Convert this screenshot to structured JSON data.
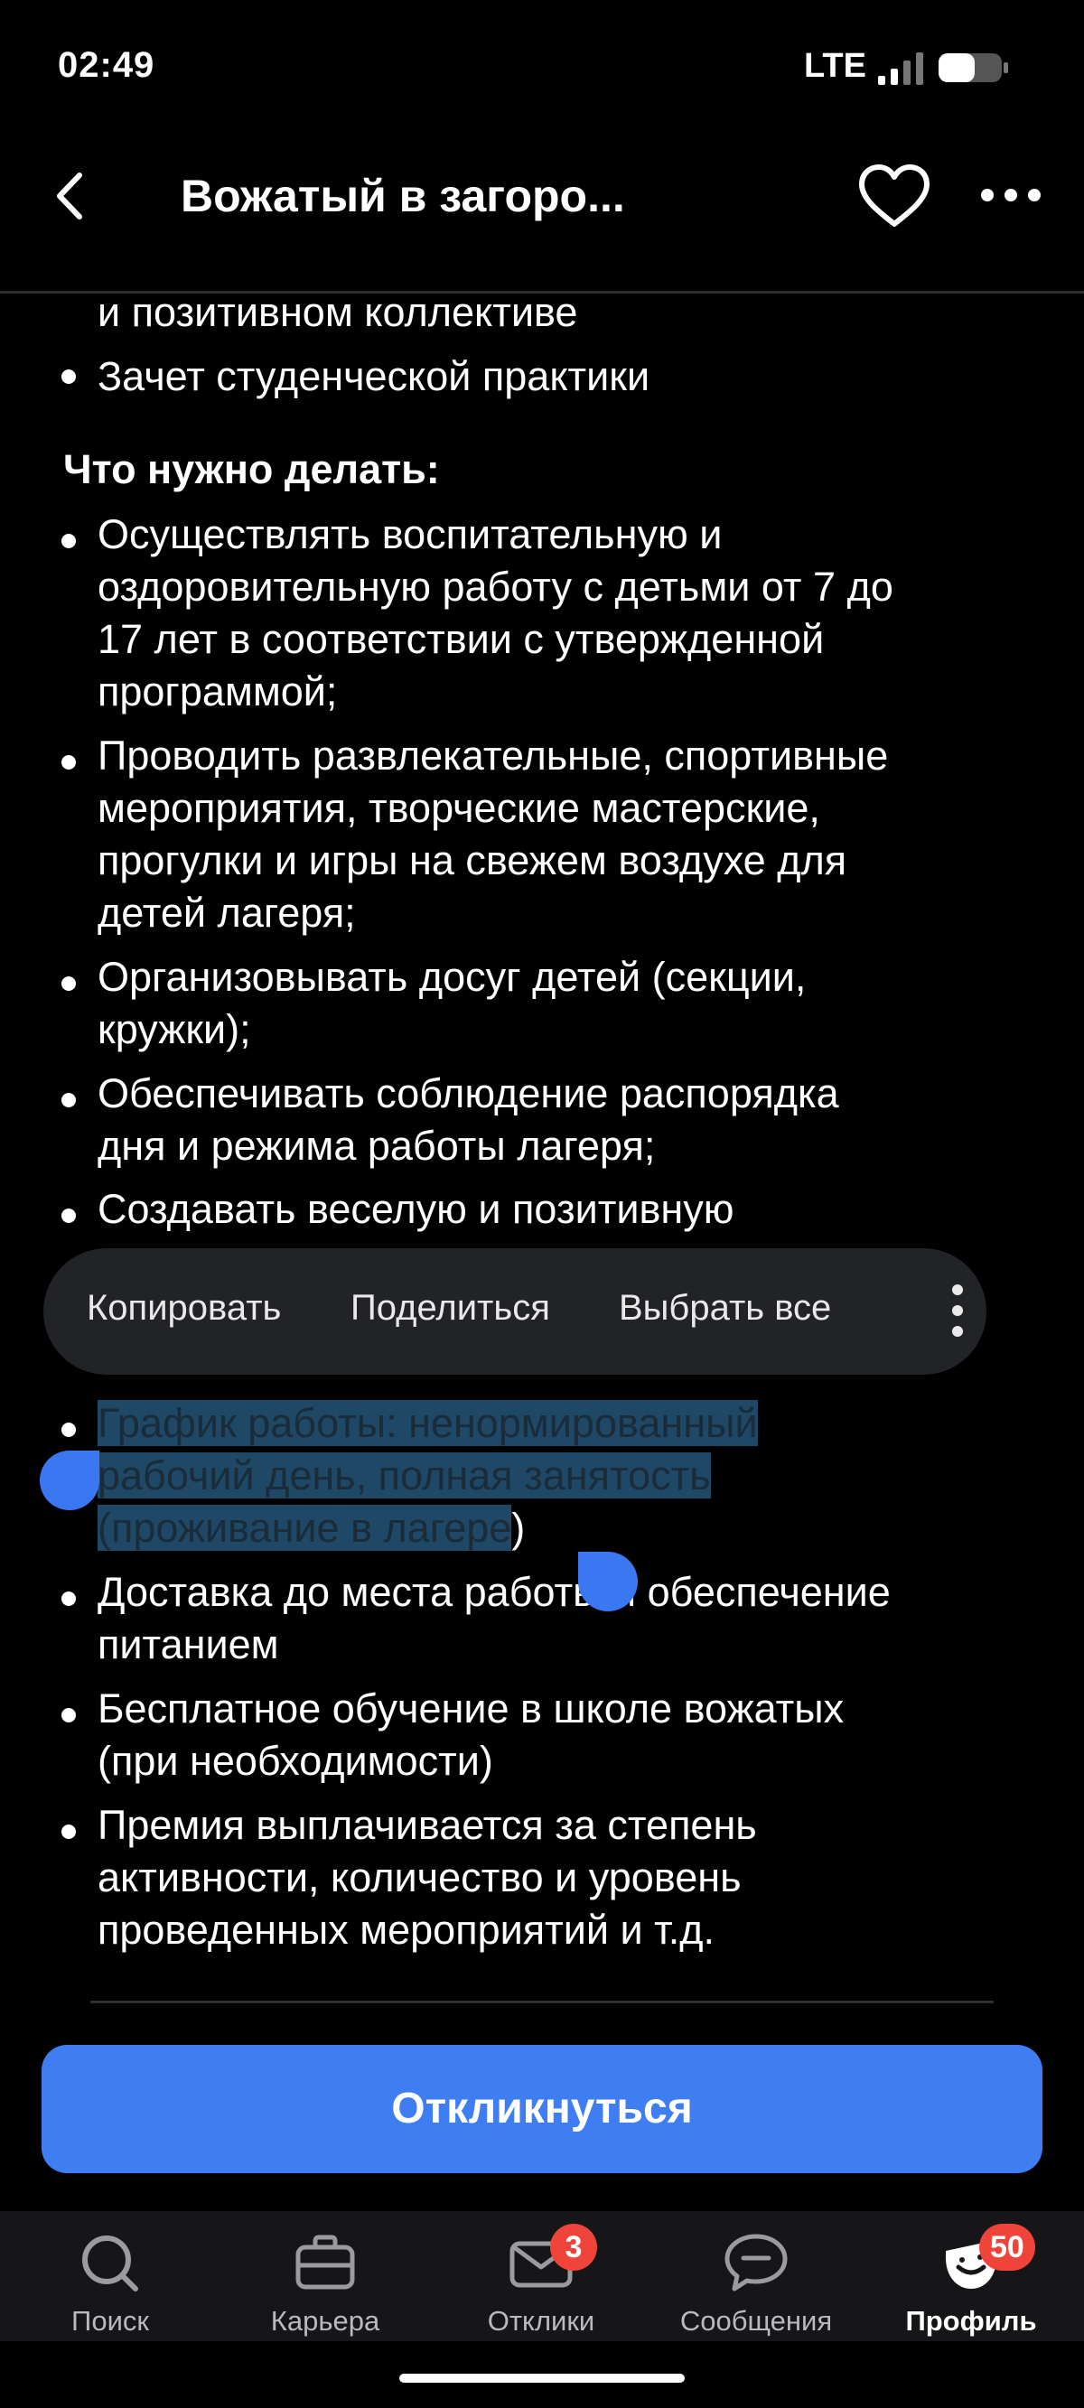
{
  "status_bar": {
    "time": "02:49",
    "network": "LTE"
  },
  "header": {
    "title": "Вожатый в загоро..."
  },
  "content": {
    "partial_line": "и позитивном коллективе",
    "benefit_practice": "Зачет студенческой практики",
    "duties_heading": "Что нужно делать:",
    "duties": [
      [
        "Осуществлять воспитательную и",
        "оздоровительную работу с детьми от 7 до",
        "17 лет в соответствии с утвержденной",
        "программой;"
      ],
      [
        "Проводить развлекательные, спортивные",
        "мероприятия, творческие мастерские,",
        "прогулки и игры на свежем воздухе для",
        "детей лагеря;"
      ],
      [
        "Организовывать досуг детей (секции,",
        "кружки);"
      ],
      [
        "Обеспечивать соблюдение распорядка",
        "дня и режима работы лагеря;"
      ],
      [
        "Создавать веселую и позитивную"
      ]
    ],
    "conditions": {
      "schedule_line1": "График работы: ненормированный",
      "schedule_line2": "рабочий день, полная занятость",
      "schedule_line3_selected": "(проживание в лагере",
      "schedule_line3_rest": ")",
      "delivery_line1": "Доставка до места работы и обеспечение",
      "delivery_line2": "питанием",
      "training_line1": "Бесплатное обучение в школе вожатых",
      "training_line2": "(при необходимости)",
      "bonus_line1": "Премия выплачивается за степень",
      "bonus_line2": "активности, количество и уровень",
      "bonus_line3": "проведенных мероприятий и т.д."
    }
  },
  "context_menu": {
    "copy": "Копировать",
    "share": "Поделиться",
    "select_all": "Выбрать все"
  },
  "apply_button": "Откликнуться",
  "bottom_nav": {
    "search": "Поиск",
    "career": "Карьера",
    "responses": "Отклики",
    "responses_badge": "3",
    "messages": "Сообщения",
    "profile": "Профиль",
    "profile_badge": "50"
  },
  "colors": {
    "accent": "#3f7ef2",
    "badge": "#f0443a",
    "selection": "#1f4766"
  }
}
